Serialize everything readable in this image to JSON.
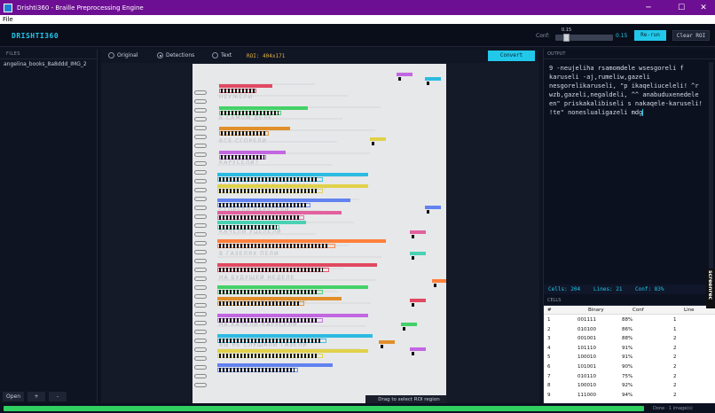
{
  "window": {
    "title": "Drishti360 - Braille Preprocessing Engine",
    "min_glyph": "─",
    "max_glyph": "☐",
    "close_glyph": "✕"
  },
  "menu": {
    "file": "File"
  },
  "header": {
    "brand": "DRISHTI360",
    "conf_label": "Conf:",
    "conf_slider_label": "0.15",
    "conf_value": "0.15",
    "conf_fraction": 0.15,
    "rerun": "Re-run",
    "clear_roi": "Clear ROI"
  },
  "files": {
    "heading": "FILES",
    "items": [
      "angelina_books_8a8ddd_IMG_2"
    ],
    "open": "Open",
    "add": "+",
    "remove": "-"
  },
  "viewer": {
    "modes": [
      "Original",
      "Detections",
      "Text"
    ],
    "selected_mode": "Detections",
    "roi": "ROI: 404x171",
    "convert": "Convert",
    "drag_hint": "Drag to select ROI region",
    "page_lines": [
      "НЕУЖЕЛИ",
      "В САМОМ ДЕЛЕ",
      "ВСЕ СГОРЕЛИ",
      "КАРУСЕЛИ?",
      "РАЗВЕ У МЕНЯ ВЫ ГАЗЕЛИ",
      "СГОРЕЛИ КАРУСЕЛИ",
      "КАЧЕЛИ УЦЕЛЕЛИ",
      "В ГАЗЕЛЯХ ПЕЛИ",
      "НА БУДУЩЕЙ НЕДЕЛЕ",
      "ПРИСКАКАЛИ ВЫ И СЕЛИ",
      "НА КАЧЕЛИ-КАРУСЕЛИ",
      "ВЫ НЕ СЛУШАЛИ ГАЗЕЛИ"
    ]
  },
  "output": {
    "heading": "OUTPUT",
    "text": "9 -neujeliha rsamomdele wsesgoreli f karuseli -aj,rumeliw,gazeli nesgorelikaruseli, \"p ikaqeliuceleli! ^r wzb,gazeli,negaldeli, ^^ anabuduxenedele en\" priskakalibiseli s nakaqele-karuseli! !te\" noneslualigazeli mdg",
    "stats": {
      "cells": "Cells: 204",
      "lines": "Lines: 21",
      "conf": "Conf: 83%"
    }
  },
  "cells": {
    "heading": "CELLS",
    "columns": [
      "#",
      "Binary",
      "Conf",
      "Line"
    ],
    "rows": [
      [
        "1",
        "001111",
        "88%",
        "1"
      ],
      [
        "2",
        "010100",
        "86%",
        "1"
      ],
      [
        "3",
        "001001",
        "88%",
        "2"
      ],
      [
        "4",
        "101110",
        "91%",
        "2"
      ],
      [
        "5",
        "100010",
        "91%",
        "2"
      ],
      [
        "6",
        "101001",
        "90%",
        "2"
      ],
      [
        "7",
        "010110",
        "75%",
        "2"
      ],
      [
        "8",
        "100010",
        "92%",
        "2"
      ],
      [
        "9",
        "111000",
        "94%",
        "2"
      ]
    ]
  },
  "brand_tab": "screenrec",
  "status": {
    "text": "Done · 1 image(s)",
    "progress_fraction": 1.0
  },
  "colors": {
    "accent": "#22c8ea",
    "titlebar": "#6d0f93",
    "progress": "#2fd060",
    "roi": "#e0b040"
  }
}
